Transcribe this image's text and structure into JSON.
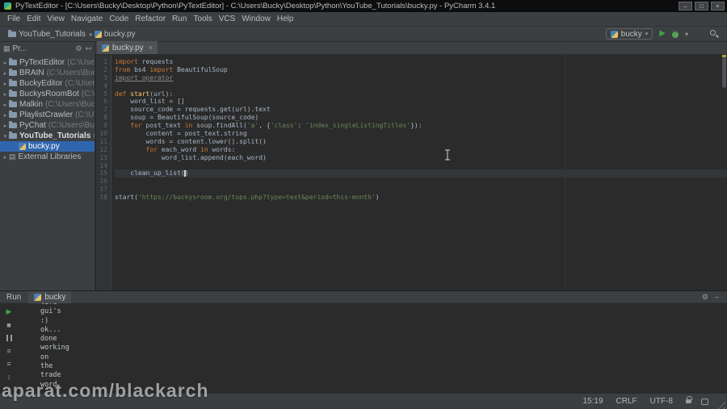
{
  "title_bar": {
    "title": "PyTextEditor - [C:\\Users\\Bucky\\Desktop\\Python\\PyTextEditor] - C:\\Users\\Bucky\\Desktop\\Python\\YouTube_Tutorials\\bucky.py - PyCharm 3.4.1"
  },
  "menu_items": [
    "File",
    "Edit",
    "View",
    "Navigate",
    "Code",
    "Refactor",
    "Run",
    "Tools",
    "VCS",
    "Window",
    "Help"
  ],
  "toolbar": {
    "breadcrumb_folder": "YouTube_Tutorials",
    "breadcrumb_file": "bucky.py",
    "run_config": "bucky"
  },
  "project_panel": {
    "header": "Pr...",
    "items": [
      {
        "name": "PyTextEditor",
        "path": "(C:\\Use",
        "type": "folder",
        "indent": 0
      },
      {
        "name": "BRAIN",
        "path": "(C:\\Users\\Buck",
        "type": "folder",
        "indent": 0
      },
      {
        "name": "BuckyEditor",
        "path": "(C:\\Users",
        "type": "folder",
        "indent": 0
      },
      {
        "name": "BuckysRoomBot",
        "path": "(C:\\U",
        "type": "folder",
        "indent": 0
      },
      {
        "name": "Malkin",
        "path": "(C:\\Users\\Buck",
        "type": "folder",
        "indent": 0
      },
      {
        "name": "PlaylistCrawler",
        "path": "(C:\\Us",
        "type": "folder",
        "indent": 0
      },
      {
        "name": "PyChat",
        "path": "(C:\\Users\\Buck",
        "type": "folder",
        "indent": 0
      },
      {
        "name": "YouTube_Tutorials",
        "path": "(C:",
        "type": "folder",
        "indent": 0,
        "expanded": true,
        "bold": true
      },
      {
        "name": "bucky.py",
        "path": "",
        "type": "pyfile",
        "indent": 1,
        "selected": true
      },
      {
        "name": "External Libraries",
        "path": "",
        "type": "libs",
        "indent": 0
      }
    ]
  },
  "editor": {
    "tab_label": "bucky.py",
    "current_line": 15,
    "lines": [
      {
        "n": 1,
        "tokens": [
          [
            "kw",
            "import"
          ],
          [
            "pl",
            " requests"
          ]
        ]
      },
      {
        "n": 2,
        "tokens": [
          [
            "kw",
            "from"
          ],
          [
            "pl",
            " bs4 "
          ],
          [
            "kw",
            "import"
          ],
          [
            "pl",
            " BeautifulSoup"
          ]
        ]
      },
      {
        "n": 3,
        "tokens": [
          [
            "unused",
            "import operator"
          ]
        ]
      },
      {
        "n": 4,
        "tokens": []
      },
      {
        "n": 5,
        "tokens": [
          [
            "kw",
            "def "
          ],
          [
            "fn",
            "start"
          ],
          [
            "pl",
            "(url):"
          ]
        ]
      },
      {
        "n": 6,
        "tokens": [
          [
            "pl",
            "    word_list = []"
          ]
        ]
      },
      {
        "n": 7,
        "tokens": [
          [
            "pl",
            "    source_code = requests.get(url).text"
          ]
        ]
      },
      {
        "n": 8,
        "tokens": [
          [
            "pl",
            "    soup = BeautifulSoup(source_code)"
          ]
        ]
      },
      {
        "n": 9,
        "tokens": [
          [
            "kw",
            "    for"
          ],
          [
            "pl",
            " post_text "
          ],
          [
            "kw",
            "in"
          ],
          [
            "pl",
            " soup.findAll("
          ],
          [
            "str",
            "'a'"
          ],
          [
            "pl",
            ", {"
          ],
          [
            "str",
            "'class'"
          ],
          [
            "pl",
            ": "
          ],
          [
            "str",
            "'index_singleListingTitles'"
          ],
          [
            "pl",
            "}):"
          ]
        ]
      },
      {
        "n": 10,
        "tokens": [
          [
            "pl",
            "        content = post_text.string"
          ]
        ]
      },
      {
        "n": 11,
        "tokens": [
          [
            "pl",
            "        words = content.lower().split()"
          ]
        ]
      },
      {
        "n": 12,
        "tokens": [
          [
            "kw",
            "        for"
          ],
          [
            "pl",
            " each_word "
          ],
          [
            "kw",
            "in"
          ],
          [
            "pl",
            " words:"
          ]
        ]
      },
      {
        "n": 13,
        "tokens": [
          [
            "pl",
            "            word_list.append(each_word)"
          ]
        ]
      },
      {
        "n": 14,
        "tokens": []
      },
      {
        "n": 15,
        "tokens": [
          [
            "pl",
            "    clean_up_list("
          ],
          [
            "caret",
            ""
          ],
          [
            "pl",
            ")"
          ]
        ]
      },
      {
        "n": 16,
        "tokens": []
      },
      {
        "n": 17,
        "tokens": []
      },
      {
        "n": 18,
        "tokens": [
          [
            "pl",
            "start("
          ],
          [
            "str",
            "'https://buckysroom.org/tops.php?type=text&period=this-month'"
          ],
          [
            "pl",
            ")"
          ]
        ]
      }
    ]
  },
  "run_panel": {
    "label": "Run",
    "tab": "bucky",
    "output": [
      "life",
      "gui's",
      ":)",
      "ok...",
      "done",
      "working",
      "on",
      "the",
      "trade",
      "word"
    ]
  },
  "status_bar": {
    "caret_position": "15:19",
    "line_separator": "CRLF",
    "encoding": "UTF-8"
  },
  "watermark": "aparat.com/blackarch",
  "icons": {
    "minimize": "–",
    "maximize": "□",
    "close": "×",
    "chevron_right": "▸",
    "chevron_down": "▾",
    "gear": "⚙",
    "collapse": "↤",
    "panel": "▦",
    "play": "▶",
    "stop": "■",
    "list": "≡",
    "updown": "↕",
    "library": "▤"
  },
  "colors": {
    "editor_background": "#2b2b2b",
    "panel_background": "#3c3f41",
    "selection_blue": "#2f65ad",
    "keyword_orange": "#cc7832",
    "string_green": "#6a8759",
    "function_yellow": "#ffc66b",
    "accent_green": "#3fa33f"
  }
}
